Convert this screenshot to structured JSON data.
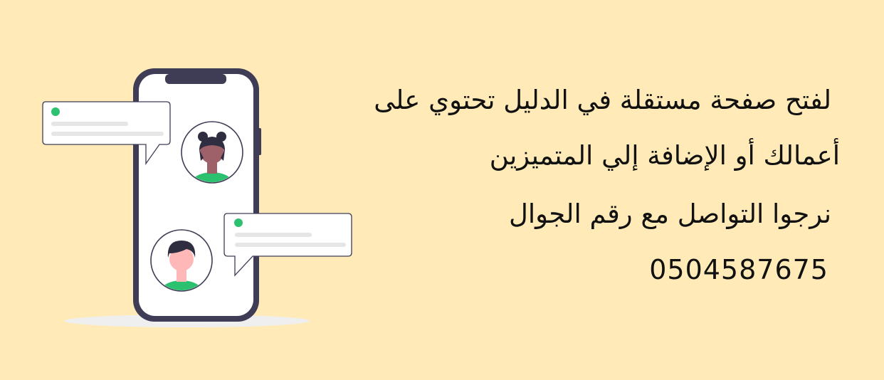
{
  "message": {
    "line1": "لفتح صفحة مستقلة في الدليل تحتوي على",
    "line2": "أعمالك أو الإضافة  إلي المتميزين",
    "line3": "نرجوا التواصل مع رقم الجوال",
    "phone": "0504587675"
  },
  "illustration": {
    "icon": "phone-chat-illustration",
    "colors": {
      "background": "#FFEAB8",
      "phone_frame": "#3F3D56",
      "screen": "#FFFFFF",
      "status_dot": "#2BC16E",
      "avatar_shirt": "#2BC16E",
      "skin_dark": "#9E616A",
      "skin_light": "#FFB8B8",
      "placeholder_line": "#E6E6E6"
    }
  }
}
